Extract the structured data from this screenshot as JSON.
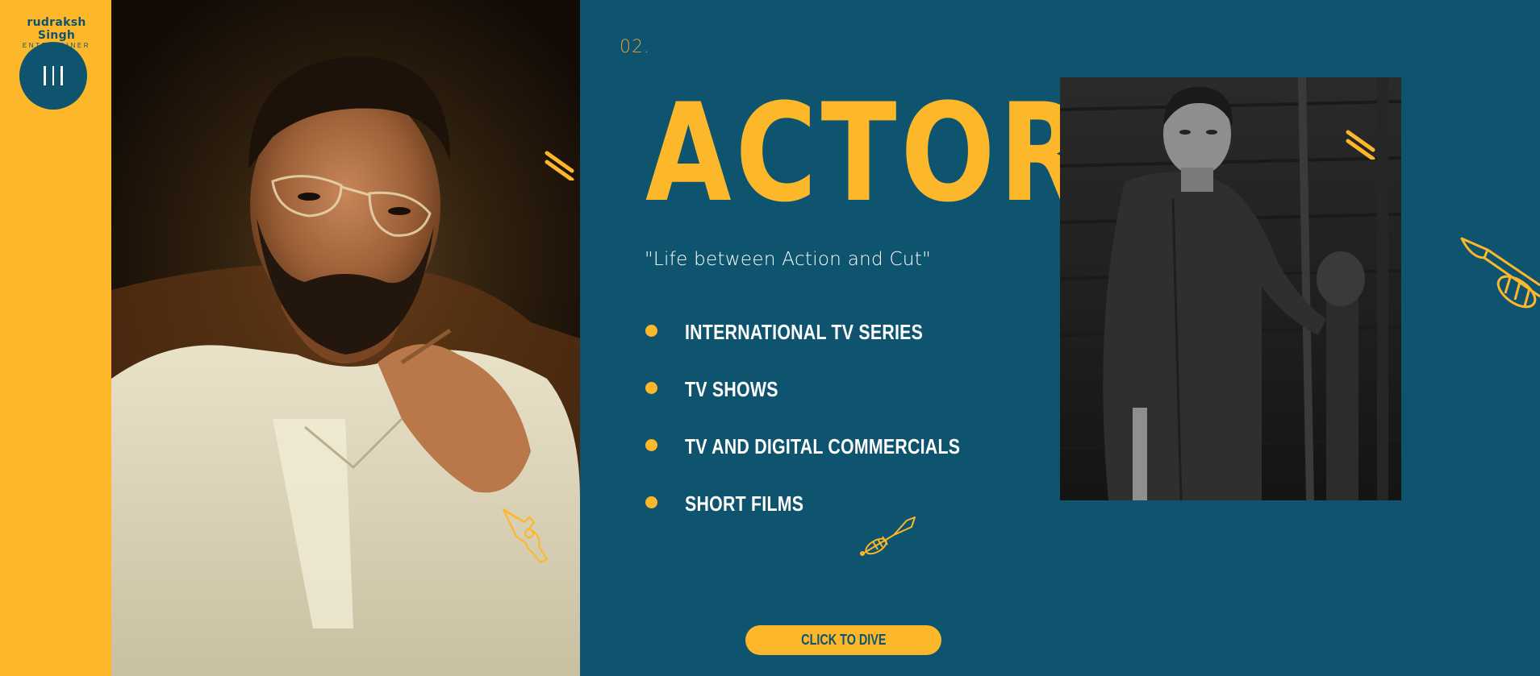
{
  "brand": {
    "name": "rudraksh Singh",
    "tagline": "ENTERTAINER"
  },
  "section": {
    "index": "02.",
    "title": "ACTOR",
    "quote": "\"Life between Action and Cut\"",
    "services": [
      {
        "label": "INTERNATIONAL TV SERIES"
      },
      {
        "label": "TV SHOWS"
      },
      {
        "label": "TV AND DIGITAL COMMERCIALS"
      },
      {
        "label": "SHORT FILMS"
      }
    ],
    "cta_label": "CLICK TO DIVE"
  },
  "colors": {
    "accent": "#fdb72b",
    "background": "#0e546e",
    "text": "#ffffff"
  },
  "icons": [
    "menu-icon",
    "revolver-icon",
    "trumpet-icon",
    "double-slash-icon"
  ]
}
